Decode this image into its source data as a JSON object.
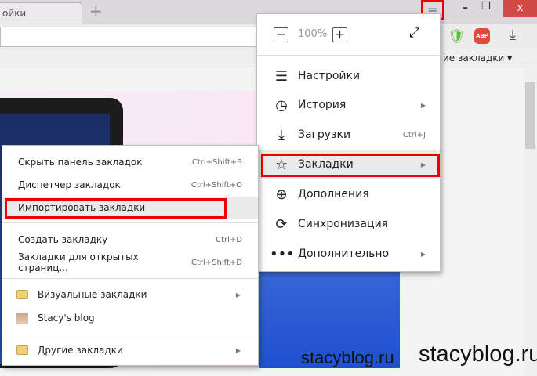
{
  "tab": {
    "title": "ойки",
    "new_tab": "+"
  },
  "window": {
    "menu_icon": "≡",
    "minimize": "–",
    "restore": "❐",
    "close": "x"
  },
  "toolbar": {
    "abp": "ABP",
    "bookmarks_bar_other": "ие закладки ▾"
  },
  "main_menu": {
    "zoom": {
      "minus": "−",
      "value": "100%",
      "plus": "+"
    },
    "items": [
      {
        "label": "Настройки",
        "icon": "settings-icon",
        "shortcut": "",
        "arrow": false
      },
      {
        "label": "История",
        "icon": "clock-icon",
        "shortcut": "",
        "arrow": true
      },
      {
        "label": "Загрузки",
        "icon": "download-icon",
        "shortcut": "Ctrl+J",
        "arrow": false
      },
      {
        "label": "Закладки",
        "icon": "star-icon",
        "shortcut": "",
        "arrow": true
      },
      {
        "label": "Дополнения",
        "icon": "plus-circle-icon",
        "shortcut": "",
        "arrow": false
      },
      {
        "label": "Синхронизация",
        "icon": "sync-icon",
        "shortcut": "",
        "arrow": false
      },
      {
        "label": "Дополнительно",
        "icon": "more-icon",
        "shortcut": "",
        "arrow": true
      }
    ]
  },
  "bookmarks_submenu": {
    "items": [
      {
        "label": "Скрыть панель закладок",
        "shortcut": "Ctrl+Shift+B"
      },
      {
        "label": "Диспетчер закладок",
        "shortcut": "Ctrl+Shift+O"
      },
      {
        "label": "Импортировать закладки",
        "shortcut": ""
      },
      {
        "label": "Создать закладку",
        "shortcut": "Ctrl+D"
      },
      {
        "label": "Закладки для открытых страниц...",
        "shortcut": "Ctrl+Shift+D"
      },
      {
        "label": "Визуальные закладки"
      },
      {
        "label": "Stacy's blog"
      },
      {
        "label": "Другие закладки"
      }
    ]
  },
  "watermarks": [
    "stacyblog.ru",
    "stacyblog.ru"
  ],
  "arrow": "▶"
}
